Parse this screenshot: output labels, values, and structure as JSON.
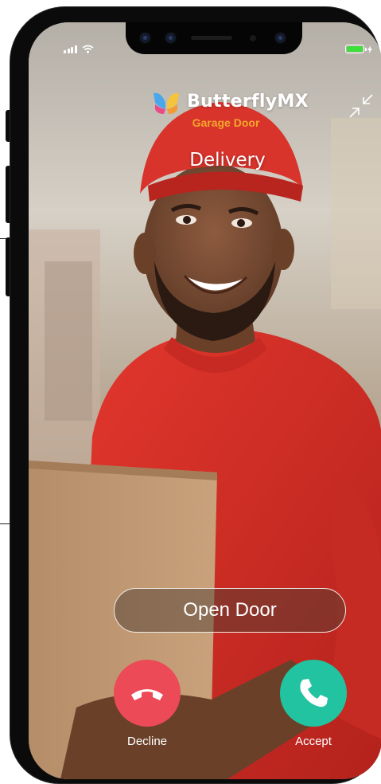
{
  "status_bar": {
    "signal_icon": "signal-bars-icon",
    "wifi_icon": "wifi-icon",
    "battery_icon": "battery-charging-icon",
    "battery_level": 1.0
  },
  "header": {
    "brand_name": "ButterflyMX",
    "brand_icon": "butterfly-logo-icon",
    "door_name": "Garage Door",
    "caller": "Delivery",
    "minimize_icon": "minimize-arrows-icon"
  },
  "actions": {
    "open_door_label": "Open Door",
    "decline_label": "Decline",
    "decline_icon": "phone-hangup-icon",
    "accept_label": "Accept",
    "accept_icon": "phone-icon"
  },
  "colors": {
    "decline": "#ec4a56",
    "accept": "#22c3a0",
    "door_name": "#f4a62a",
    "battery": "#3ce03c"
  }
}
